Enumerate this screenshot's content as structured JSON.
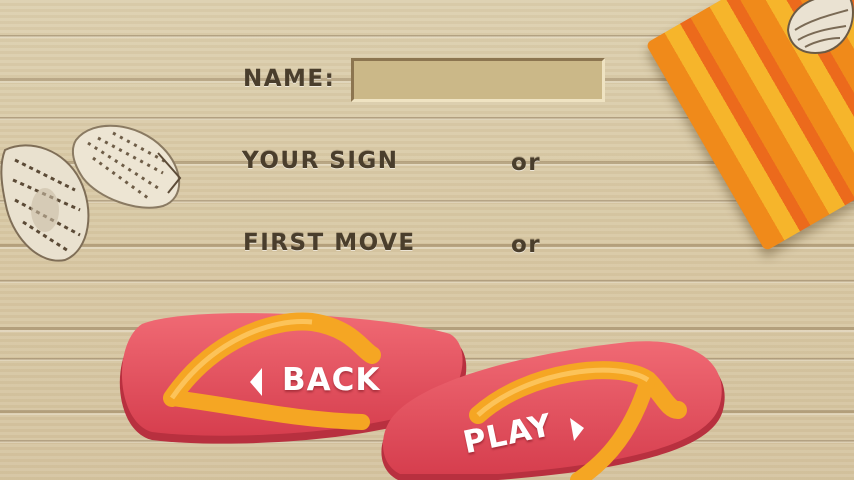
{
  "form": {
    "name_label": "NAME:",
    "name_value": "",
    "sign_label": "YOUR SIGN",
    "sign_or": "or",
    "move_label": "FIRST MOVE",
    "move_or": "or"
  },
  "buttons": {
    "back_label": "BACK",
    "play_label": "PLAY"
  },
  "colors": {
    "wood": "#d8c8a4",
    "label_text": "#4a3e2c",
    "flipflop_pink": "#e8505c",
    "strap_yellow": "#f5a623",
    "towel_orange": "#f08a1a"
  },
  "decor": {
    "icons": [
      "seashell-icon",
      "beach-towel-icon",
      "flip-flop-icon"
    ]
  }
}
